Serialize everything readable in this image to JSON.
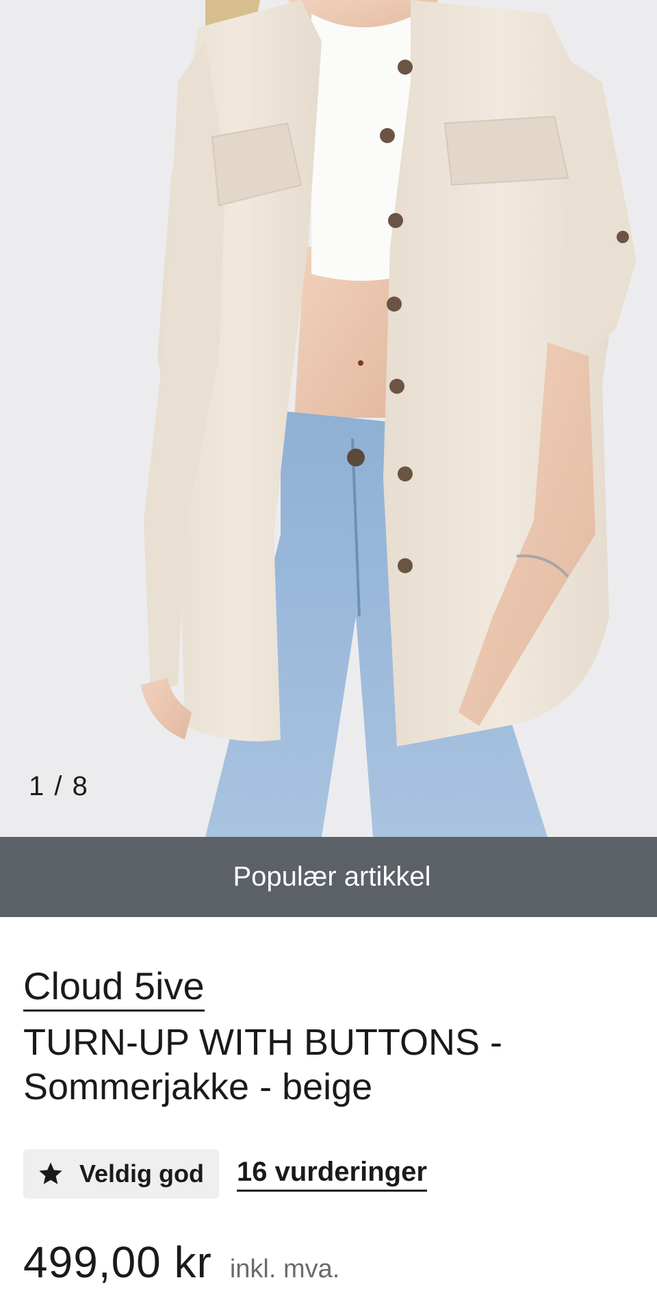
{
  "gallery": {
    "counter": "1 / 8",
    "image_description": "product-photo-beige-shirt-jacket"
  },
  "banner": {
    "label": "Populær artikkel"
  },
  "product": {
    "brand": "Cloud 5ive",
    "name": "TURN-UP WITH BUTTONS - Sommerjakke - beige"
  },
  "rating": {
    "icon": "star-icon",
    "label": "Veldig god",
    "reviews_link": "16 vurderinger"
  },
  "price": {
    "amount": "499,00 kr",
    "vat_note": "inkl. mva."
  },
  "colors": {
    "banner_bg": "#5c6168",
    "gallery_bg": "#ececee",
    "badge_bg": "#efeff0"
  }
}
